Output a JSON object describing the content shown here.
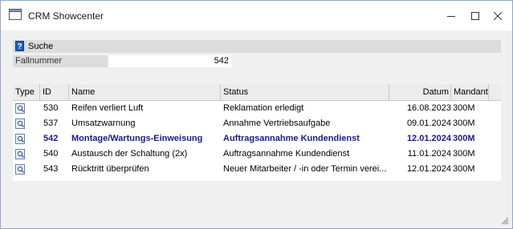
{
  "window": {
    "title": "CRM Showcenter"
  },
  "search": {
    "label": "Suche",
    "help_symbol": "?"
  },
  "filter": {
    "label": "Fallnummer",
    "value": "542"
  },
  "table": {
    "columns": [
      "Type",
      "ID",
      "Name",
      "Status",
      "Datum",
      "Mandant"
    ],
    "rows": [
      {
        "id": "530",
        "name": "Reifen verliert Luft",
        "status": "Reklamation erledigt",
        "datum": "16.08.2023",
        "mandant": "300M",
        "bold": false
      },
      {
        "id": "537",
        "name": "Umsatzwarnung",
        "status": "Annahme Vertriebsaufgabe",
        "datum": "09.01.2024",
        "mandant": "300M",
        "bold": false
      },
      {
        "id": "542",
        "name": "Montage/Wartungs-Einweisung",
        "status": "Auftragsannahme Kundendienst",
        "datum": "12.01.2024",
        "mandant": "300M",
        "bold": true
      },
      {
        "id": "540",
        "name": "Austausch der Schaltung (2x)",
        "status": "Auftragsannahme Kundendienst",
        "datum": "11.01.2024",
        "mandant": "300M",
        "bold": false
      },
      {
        "id": "543",
        "name": "Rücktritt überprüfen",
        "status": "Neuer Mitarbeiter / -in oder Termin verei...",
        "datum": "12.01.2024",
        "mandant": "300M",
        "bold": false
      }
    ]
  },
  "icons": {
    "row_type": "document-magnifier-icon",
    "app": "crm-window-icon"
  },
  "colors": {
    "highlight_text": "#1a1a8c",
    "window_border": "#8fa8c8"
  }
}
